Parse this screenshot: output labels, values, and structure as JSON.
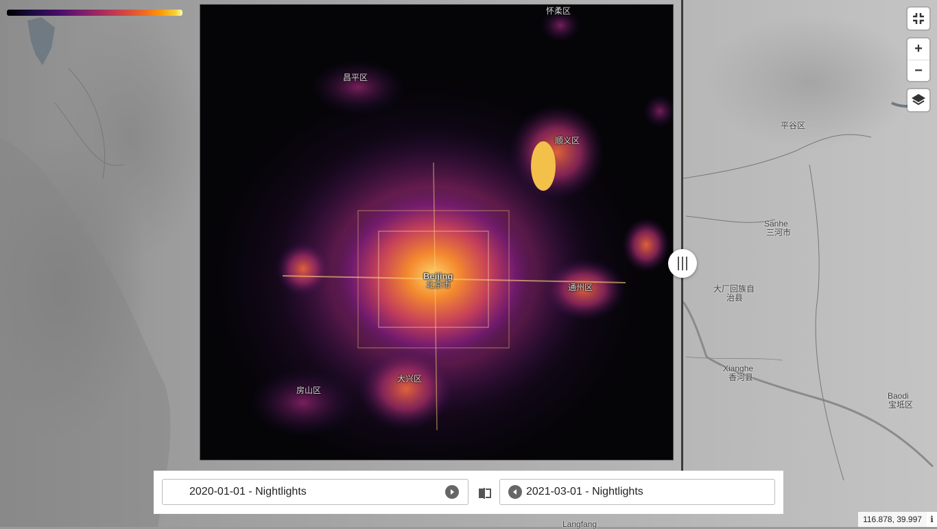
{
  "map": {
    "places": {
      "huairou": "怀柔区",
      "changping": "昌平区",
      "shunyi": "顺义区",
      "pinggu": "平谷区",
      "sanhe_en": "Sanhe",
      "sanhe_zh": "三河市",
      "dachang": "大厂回族自",
      "dachang2": "治县",
      "beijing_en": "Beijing",
      "beijing_zh": "北京市",
      "tongzhou": "通州区",
      "daxing": "大兴区",
      "fangshan": "房山区",
      "xianghe_en": "Xianghe",
      "xianghe_zh": "香河县",
      "baodi_en": "Baodi",
      "baodi_zh": "宝坻区",
      "langfang_en": "Langfang"
    },
    "colorbar": {
      "colors": [
        "#000004",
        "#4a0c6b",
        "#a52c60",
        "#ed6925",
        "#fcffa4"
      ]
    }
  },
  "controls": {
    "fullscreen_icon": "exit-fullscreen-icon",
    "zoom_in_label": "+",
    "zoom_out_label": "−",
    "layers_icon": "layers-icon"
  },
  "compare": {
    "left_date": "2020-01-01 - Nightlights",
    "right_date": "2021-03-01 - Nightlights",
    "left_nav_icon": "play-right-icon",
    "right_nav_icon": "play-left-icon",
    "swap_icon": "compare-swap-icon"
  },
  "status": {
    "coordinates": "116.878, 39.997",
    "info_label": "i"
  }
}
